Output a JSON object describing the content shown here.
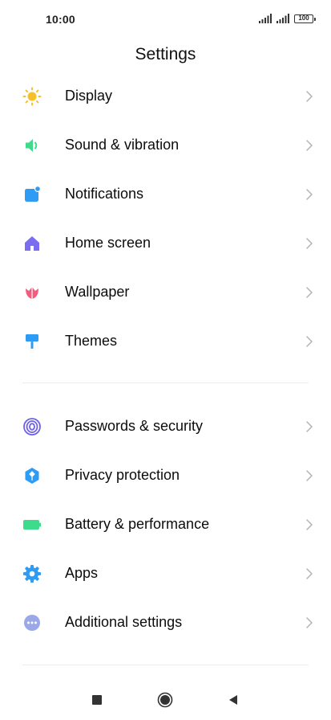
{
  "status": {
    "time": "10:00",
    "battery": "100",
    "icons": [
      "signal-icon",
      "signal-icon",
      "battery-icon"
    ]
  },
  "header": {
    "title": "Settings"
  },
  "groups": [
    {
      "items": [
        {
          "label": "Display",
          "icon": "sun-icon",
          "color": "#F7C02A"
        },
        {
          "label": "Sound & vibration",
          "icon": "speaker-icon",
          "color": "#3DDB8B"
        },
        {
          "label": "Notifications",
          "icon": "notification-icon",
          "color": "#2E9BF4"
        },
        {
          "label": "Home screen",
          "icon": "home-icon",
          "color": "#7B6CF2"
        },
        {
          "label": "Wallpaper",
          "icon": "tulip-icon",
          "color": "#F25C7E"
        },
        {
          "label": "Themes",
          "icon": "paint-roller-icon",
          "color": "#2E9BF4"
        }
      ]
    },
    {
      "items": [
        {
          "label": "Passwords & security",
          "icon": "fingerprint-icon",
          "color": "#6D62E8"
        },
        {
          "label": "Privacy protection",
          "icon": "shield-icon",
          "color": "#2E9BF4"
        },
        {
          "label": "Battery & performance",
          "icon": "battery-full-icon",
          "color": "#3DDB8B"
        },
        {
          "label": "Apps",
          "icon": "gear-icon",
          "color": "#2E9BF4"
        },
        {
          "label": "Additional settings",
          "icon": "more-dots-icon",
          "color": "#9AA8E8"
        }
      ]
    }
  ],
  "navbar": {
    "icons": [
      "recents-square-icon",
      "home-circle-icon",
      "back-triangle-icon"
    ]
  }
}
